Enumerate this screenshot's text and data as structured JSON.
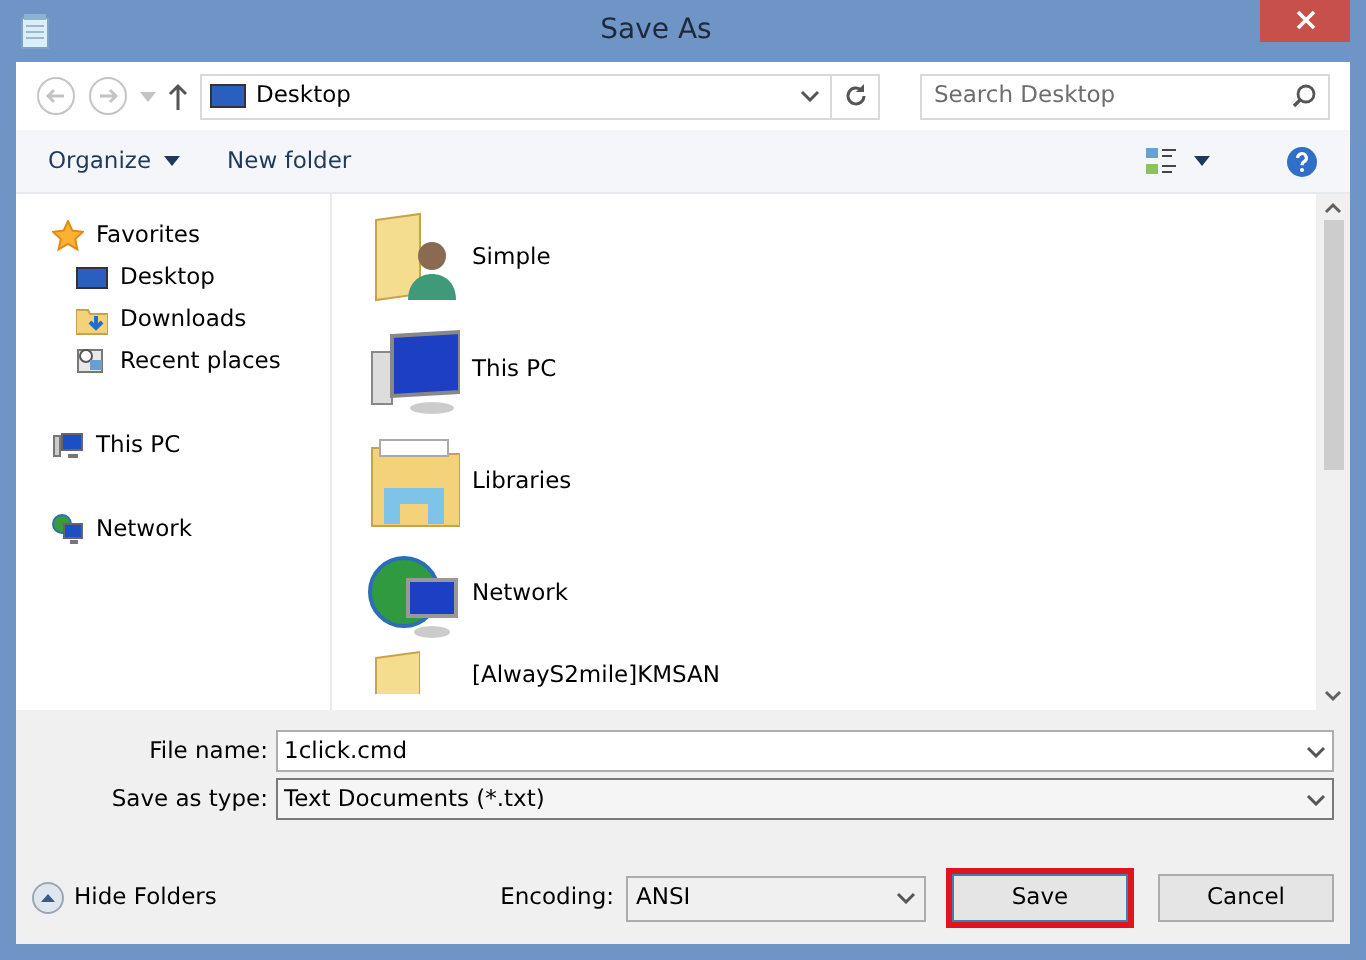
{
  "window": {
    "title": "Save As"
  },
  "address_bar": {
    "location": "Desktop"
  },
  "search": {
    "placeholder": "Search Desktop"
  },
  "toolbar": {
    "organize": "Organize",
    "new_folder": "New folder"
  },
  "sidebar": {
    "items": [
      {
        "label": "Favorites",
        "kind": "star",
        "children": [
          {
            "label": "Desktop",
            "kind": "desktop"
          },
          {
            "label": "Downloads",
            "kind": "downloads"
          },
          {
            "label": "Recent places",
            "kind": "recent"
          }
        ]
      },
      {
        "label": "This PC",
        "kind": "pc"
      },
      {
        "label": "Network",
        "kind": "network"
      }
    ]
  },
  "files": [
    {
      "name": "Simple",
      "kind": "user-folder"
    },
    {
      "name": "This PC",
      "kind": "pc"
    },
    {
      "name": "Libraries",
      "kind": "libraries"
    },
    {
      "name": "Network",
      "kind": "network"
    },
    {
      "name": "[AlwayS2mile]KMSAN",
      "kind": "folder"
    }
  ],
  "form": {
    "file_name_label": "File name:",
    "file_name": "1click.cmd",
    "type_label": "Save as type:",
    "type": "Text Documents (*.txt)"
  },
  "footer": {
    "hide_folders": "Hide Folders",
    "encoding_label": "Encoding:",
    "encoding": "ANSI",
    "save": "Save",
    "save_highlighted": true,
    "cancel": "Cancel"
  }
}
